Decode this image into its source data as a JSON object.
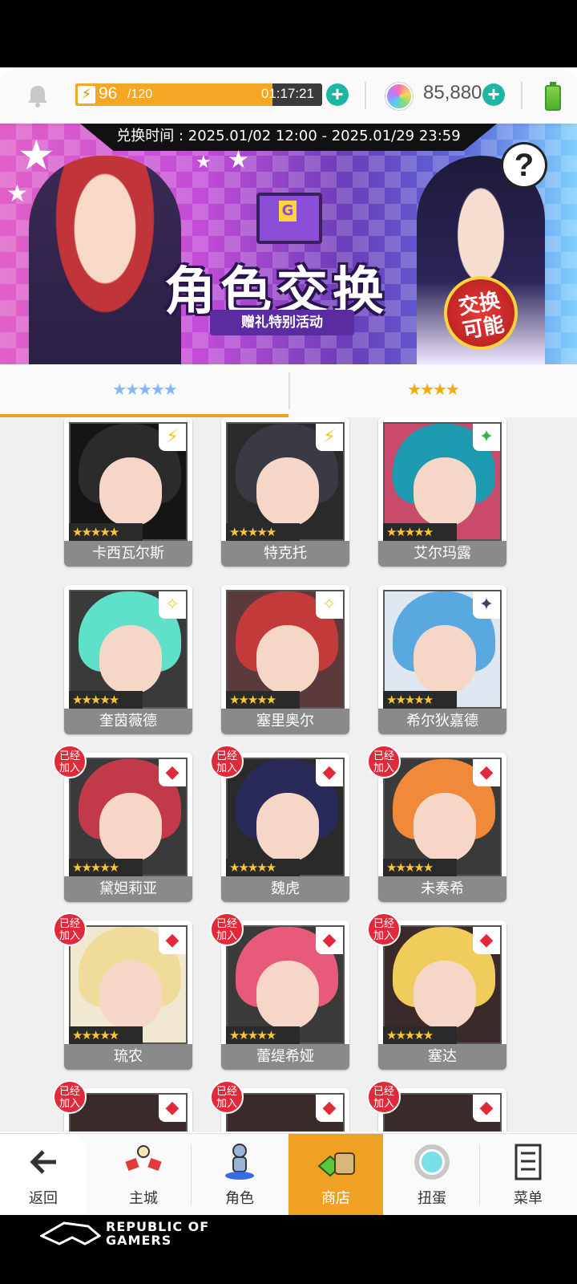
{
  "header": {
    "energy_current": "96",
    "energy_max": "/120",
    "energy_fill_percent": 80,
    "energy_timer": "01:17:21",
    "gem_count": "85,880"
  },
  "banner": {
    "period": "兑换时间 : 2025.01/02 12:00 - 2025.01/29 23:59",
    "title": "角色交换",
    "subtitle": "赠礼特别活动",
    "badge": "交换可能"
  },
  "tabs": [
    {
      "label": "★★★★★"
    },
    {
      "label": "★★★★"
    }
  ],
  "grid": {
    "joined_label": "已经加入",
    "stars": "★★★★★",
    "cards": [
      {
        "name": "卡西瓦尔斯",
        "element": "⚡",
        "element_color": "#f2c230",
        "joined": false,
        "hair": "#2b2b2b",
        "bg": "#151515"
      },
      {
        "name": "特克托",
        "element": "⚡",
        "element_color": "#f2c230",
        "joined": false,
        "hair": "#3a3a44",
        "bg": "#2a2a2a"
      },
      {
        "name": "艾尔玛露",
        "element": "✦",
        "element_color": "#3ab54a",
        "joined": false,
        "hair": "#1e9ab0",
        "bg": "#c94a6a"
      },
      {
        "name": "奎茵薇德",
        "element": "✧",
        "element_color": "#e8d24a",
        "joined": false,
        "hair": "#5fe0c8",
        "bg": "#3a3a3a"
      },
      {
        "name": "塞里奥尔",
        "element": "✧",
        "element_color": "#e8d24a",
        "joined": false,
        "hair": "#c23a3a",
        "bg": "#5a3a3a"
      },
      {
        "name": "希尔狄嘉德",
        "element": "✦",
        "element_color": "#4a3a6a",
        "joined": false,
        "hair": "#5aa8e0",
        "bg": "#dfe8f0"
      },
      {
        "name": "黛妲莉亚",
        "element": "◆",
        "element_color": "#e02a3a",
        "joined": true,
        "hair": "#c23a4a",
        "bg": "#3a3a3a"
      },
      {
        "name": "魏虎",
        "element": "◆",
        "element_color": "#e02a3a",
        "joined": true,
        "hair": "#2a2a5a",
        "bg": "#2a2a2a"
      },
      {
        "name": "未奏希",
        "element": "◆",
        "element_color": "#e02a3a",
        "joined": true,
        "hair": "#f08a3a",
        "bg": "#3a3a3a"
      },
      {
        "name": "琉农",
        "element": "◆",
        "element_color": "#e02a3a",
        "joined": true,
        "hair": "#f0dc9a",
        "bg": "#f0e8d0"
      },
      {
        "name": "蕾缇希娅",
        "element": "◆",
        "element_color": "#e02a3a",
        "joined": true,
        "hair": "#e85a7a",
        "bg": "#3a3a3a"
      },
      {
        "name": "塞达",
        "element": "◆",
        "element_color": "#e02a3a",
        "joined": true,
        "hair": "#f0cc5a",
        "bg": "#3a2a2a"
      }
    ],
    "partial_joined": [
      "已经加入",
      "已经加入",
      "已经加入"
    ]
  },
  "nav": {
    "back": "返回",
    "main_city": "主城",
    "character": "角色",
    "shop": "商店",
    "gacha": "扭蛋",
    "menu": "菜单"
  },
  "watermark": {
    "line1": "REPUBLIC OF",
    "line2": "GAMERS"
  },
  "colors": {
    "accent": "#f0a022",
    "teal": "#1fb5a3",
    "joined_red": "#e02a3a"
  }
}
